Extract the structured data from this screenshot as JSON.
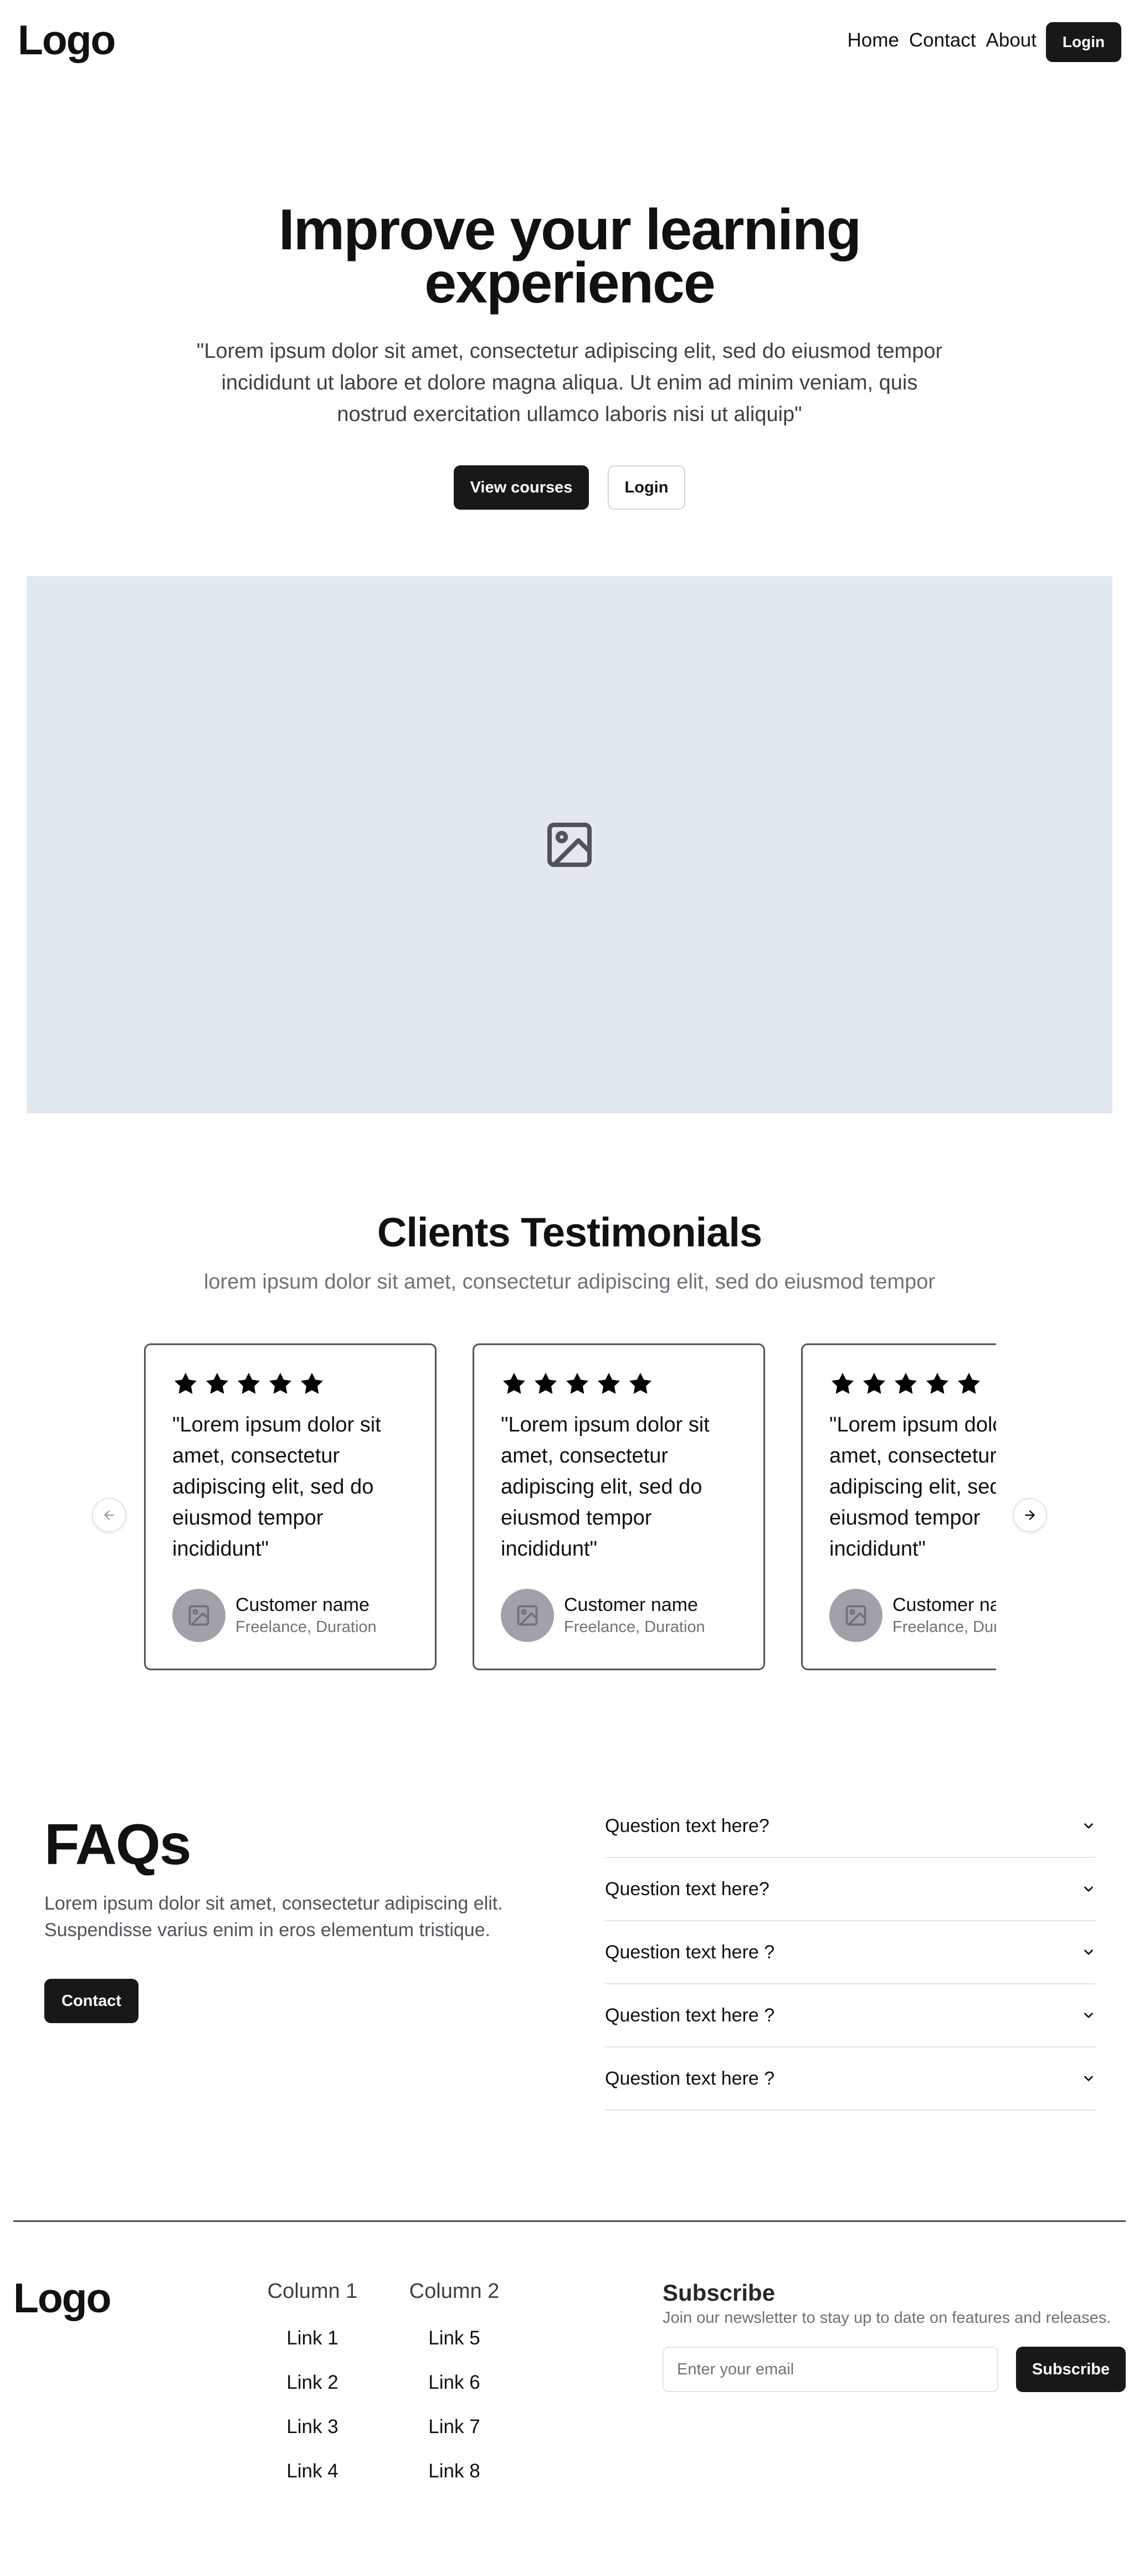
{
  "nav": {
    "logo": "Logo",
    "links": [
      "Home",
      "Contact",
      "About"
    ],
    "login_label": "Login"
  },
  "hero": {
    "title_line1": "Improve your learning",
    "title_line2": "experience",
    "description": "\"Lorem ipsum dolor sit amet, consectetur adipiscing elit, sed do eiusmod tempor incididunt ut labore et dolore magna aliqua. Ut enim ad minim veniam, quis nostrud exercitation ullamco laboris nisi ut aliquip\"",
    "primary_button": "View courses",
    "secondary_button": "Login",
    "image_icon": "image-placeholder-icon"
  },
  "testimonials": {
    "title": "Clients Testimonials",
    "subtitle": "lorem ipsum dolor sit amet, consectetur adipiscing elit, sed do eiusmod tempor",
    "rating": 5,
    "cards": [
      {
        "quote": "\"Lorem ipsum dolor sit amet, consectetur adipiscing elit, sed do eiusmod tempor incididunt\"",
        "name": "Customer name",
        "role": "Freelance, Duration"
      },
      {
        "quote": "\"Lorem ipsum dolor sit amet, consectetur adipiscing elit, sed do eiusmod tempor incididunt\"",
        "name": "Customer name",
        "role": "Freelance, Duration"
      },
      {
        "quote": "\"Lorem ipsum dolor sit amet, consectetur adipiscing elit, sed do eiusmod tempor incididunt\"",
        "name": "Customer name",
        "role": "Freelance, Duration"
      }
    ]
  },
  "faq": {
    "title": "FAQs",
    "description": "Lorem ipsum dolor sit amet, consectetur adipiscing elit. Suspendisse varius enim in eros elementum tristique.",
    "contact_label": "Contact",
    "questions": [
      "Question text here?",
      "Question text here?",
      "Question text here ?",
      "Question text here ?",
      "Question text here ?"
    ]
  },
  "footer": {
    "logo": "Logo",
    "columns": [
      {
        "title": "Column 1",
        "links": [
          "Link 1",
          "Link 2",
          "Link 3",
          "Link 4"
        ]
      },
      {
        "title": "Column 2",
        "links": [
          "Link 5",
          "Link 6",
          "Link 7",
          "Link 8"
        ]
      }
    ],
    "subscribe": {
      "title": "Subscribe",
      "description": "Join our newsletter to stay up to date on features and releases.",
      "placeholder": "Enter your email",
      "button_label": "Subscribe"
    }
  },
  "colors": {
    "primary_button": "#18181b",
    "image_placeholder_bg": "#e2e8f0",
    "muted_text": "#71717a"
  }
}
